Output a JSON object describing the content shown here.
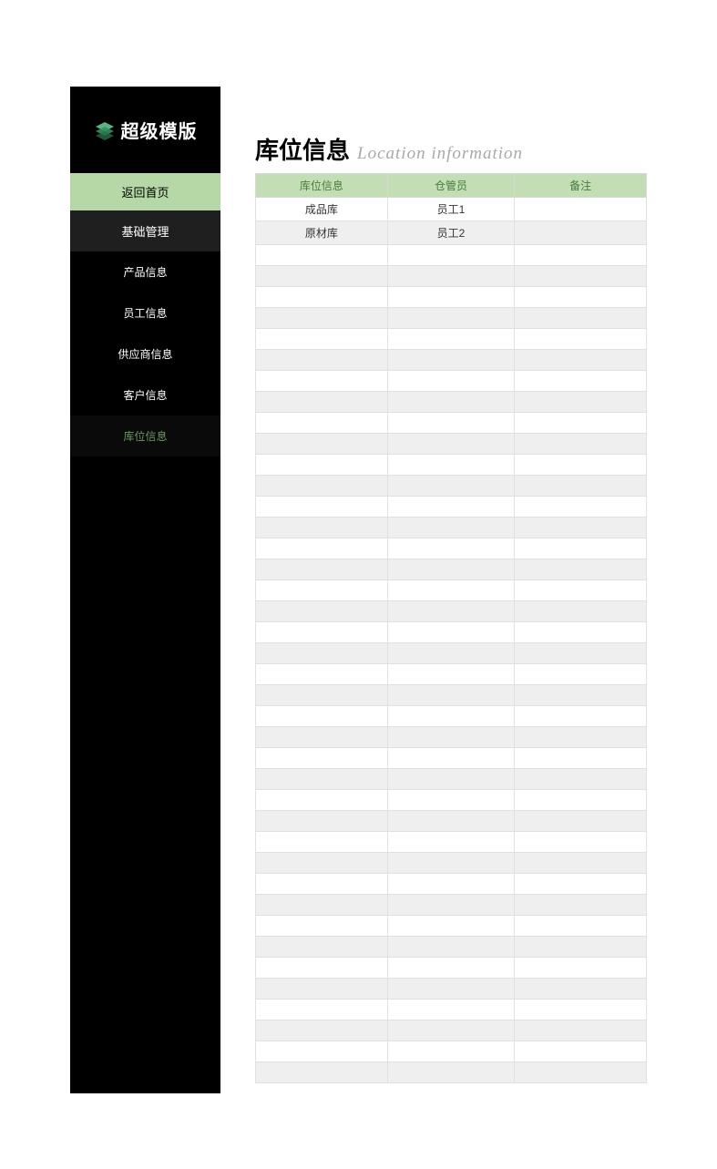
{
  "logo": {
    "text": "超级模版"
  },
  "sidebar": {
    "home": "返回首页",
    "section": "基础管理",
    "items": [
      {
        "label": "产品信息"
      },
      {
        "label": "员工信息"
      },
      {
        "label": "供应商信息"
      },
      {
        "label": "客户信息"
      },
      {
        "label": "库位信息"
      }
    ]
  },
  "page": {
    "title_main": "库位信息",
    "title_sub": "Location information"
  },
  "table": {
    "headers": {
      "location": "库位信息",
      "manager": "仓管员",
      "remark": "备注"
    },
    "rows": [
      {
        "location": "成品库",
        "manager": "员工1",
        "remark": ""
      },
      {
        "location": "原材库",
        "manager": "员工2",
        "remark": ""
      }
    ],
    "empty_rows": 40
  }
}
